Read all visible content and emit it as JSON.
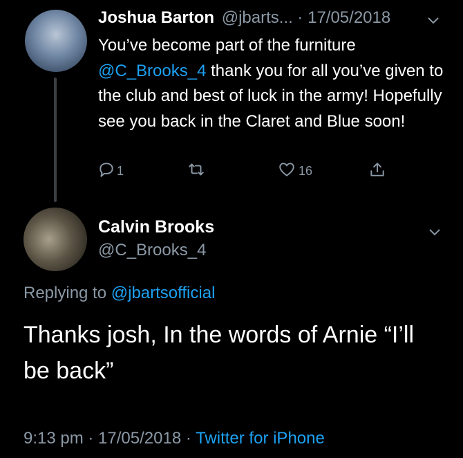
{
  "tweet1": {
    "author_name": "Joshua Barton",
    "author_handle": "@jbarts...",
    "separator": " · ",
    "date": "17/05/2018",
    "body_line1": "You’ve become part of the furniture",
    "mention": "@C_Brooks_4",
    "body_rest": " thank you for all you’ve given to the club and best of luck in the army! Hopefully see you back in the Claret and Blue soon!",
    "actions": {
      "reply_count": "1",
      "retweet_count": "",
      "like_count": "16"
    }
  },
  "tweet2": {
    "author_name": "Calvin Brooks",
    "author_handle": "@C_Brooks_4",
    "replying_prefix": "Replying to ",
    "replying_to": "@jbartsofficial",
    "body": "Thanks josh, In the words of Arnie “I’ll be back”",
    "time": "9:13 pm",
    "date": "17/05/2018",
    "source": "Twitter for iPhone"
  },
  "icons": {
    "dropdown": "chevron-down-icon",
    "reply": "reply-icon",
    "retweet": "retweet-icon",
    "like": "heart-icon",
    "share": "share-icon"
  },
  "colors": {
    "background": "#000000",
    "link": "#1da1f2",
    "muted": "#8b98a5",
    "thread_line": "#3a3f44"
  }
}
